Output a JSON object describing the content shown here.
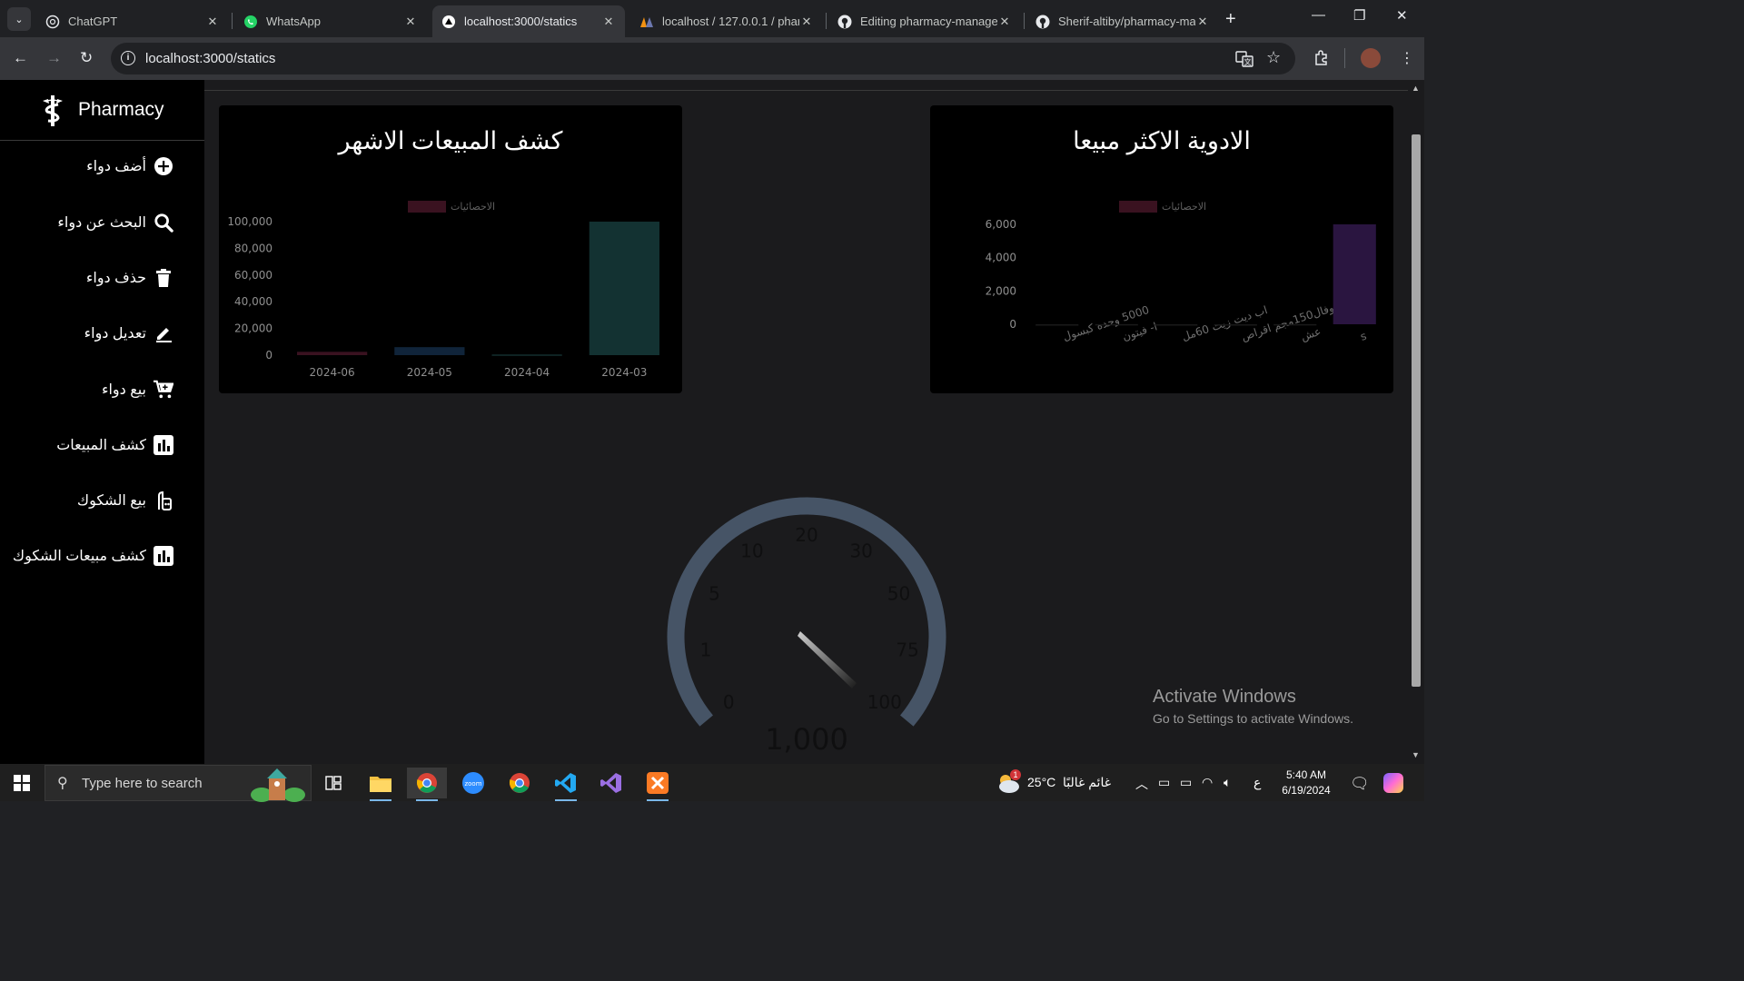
{
  "browser": {
    "tabs": [
      {
        "title": "ChatGPT",
        "icon": "chatgpt-icon"
      },
      {
        "title": "WhatsApp",
        "icon": "whatsapp-icon"
      },
      {
        "title": "localhost:3000/statics",
        "icon": "nextjs-icon",
        "active": true
      },
      {
        "title": "localhost / 127.0.0.1 / phar",
        "icon": "phpmyadmin-icon"
      },
      {
        "title": "Editing pharmacy-manage",
        "icon": "github-icon"
      },
      {
        "title": "Sherif-altiby/pharmacy-ma",
        "icon": "github-icon"
      }
    ],
    "url": "localhost:3000/statics"
  },
  "sidebar": {
    "brand": "Pharmacy",
    "items": [
      {
        "label": "أضف دواء",
        "icon": "plus-circle-icon"
      },
      {
        "label": "البحث عن دواء",
        "icon": "search-icon"
      },
      {
        "label": "حذف دواء",
        "icon": "trash-icon"
      },
      {
        "label": "تعديل دواء",
        "icon": "pencil-icon"
      },
      {
        "label": "بيع دواء",
        "icon": "cart-icon"
      },
      {
        "label": "كشف المبيعات",
        "icon": "bar-chart-icon"
      },
      {
        "label": "بيع الشكوك",
        "icon": "receipt-icon"
      },
      {
        "label": "كشف مبيعات الشكوك",
        "icon": "bar-chart-icon"
      }
    ]
  },
  "chart_data": [
    {
      "type": "bar",
      "title": "كشف المبيعات الاشهر",
      "legend": "الاحصائيات",
      "categories": [
        "2024-06",
        "2024-05",
        "2024-04",
        "2024-03"
      ],
      "values": [
        2500,
        6000,
        500,
        100000
      ],
      "colors": [
        "#3a1220",
        "#10243a",
        "#142e2e",
        "#133232"
      ],
      "yticks": [
        "0",
        "20,000",
        "40,000",
        "60,000",
        "80,000",
        "100,000"
      ],
      "ylim": [
        0,
        100000
      ]
    },
    {
      "type": "bar",
      "title": "الادوية الاكثر مبيعا",
      "legend": "الاحصائيات",
      "categories": [
        "5000 وحده كبسول",
        "ا- فيتون",
        "اب ديت زيت 60مل",
        "ابروفال150مجم اقراص",
        "عش",
        "s"
      ],
      "values": [
        0,
        10,
        0,
        0,
        10,
        7000
      ],
      "colors": [
        "#1a1a1a",
        "#1a1a1a",
        "#1a1a1a",
        "#1a1a1a",
        "#1a1a1a",
        "#2a1540"
      ],
      "yticks": [
        "0",
        "2,000",
        "4,000",
        "6,000"
      ],
      "ylim": [
        0,
        7000
      ]
    }
  ],
  "gauge": {
    "ticks": [
      "0",
      "1",
      "5",
      "10",
      "20",
      "30",
      "50",
      "75",
      "100"
    ],
    "value_label": "1,000"
  },
  "watermark": {
    "line1": "Activate Windows",
    "line2": "Go to Settings to activate Windows."
  },
  "taskbar": {
    "search_placeholder": "Type here to search",
    "weather": "25°C",
    "weather_desc": "غائم غالبًا",
    "weather_badge": "1",
    "lang": "ع",
    "time": "5:40 AM",
    "date": "6/19/2024"
  }
}
